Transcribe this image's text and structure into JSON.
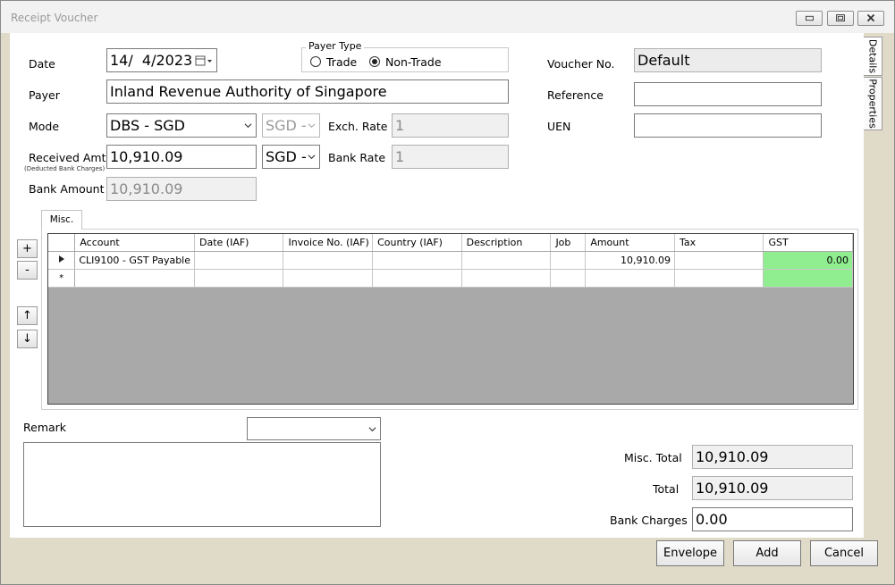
{
  "window": {
    "title": "Receipt Voucher"
  },
  "side_tabs": [
    "Details",
    "Properties"
  ],
  "form": {
    "date_label": "Date",
    "date_value": "14/  4/2023",
    "payer_type_title": "Payer Type",
    "payer_type_options": [
      "Trade",
      "Non-Trade"
    ],
    "payer_type_selected": "Non-Trade",
    "voucher_no_label": "Voucher No.",
    "voucher_no_value": "Default",
    "payer_label": "Payer",
    "payer_value": "Inland Revenue Authority of Singapore",
    "reference_label": "Reference",
    "reference_value": "",
    "mode_label": "Mode",
    "mode_value": "DBS - SGD",
    "mode_currency_value": "SGD -",
    "exch_rate_label": "Exch. Rate",
    "exch_rate_value": "1",
    "uen_label": "UEN",
    "uen_value": "",
    "received_amt_label": "Received Amt",
    "received_amt_note": "(Deducted Bank Charges)",
    "received_amt_value": "10,910.09",
    "received_currency_value": "SGD -",
    "bank_rate_label": "Bank Rate",
    "bank_rate_value": "1",
    "bank_amount_label": "Bank Amount",
    "bank_amount_value": "10,910.09"
  },
  "misc_tab": {
    "label": "Misc."
  },
  "side_buttons": {
    "add": "+",
    "remove": "-",
    "up": "↑",
    "down": "↓"
  },
  "grid": {
    "columns": [
      "Account",
      "Date (IAF)",
      "Invoice No. (IAF)",
      "Country (IAF)",
      "Description",
      "Job",
      "Amount",
      "Tax",
      "GST"
    ],
    "rows": [
      [
        "CLI9100 - GST Payable",
        "",
        "",
        "",
        "",
        "",
        "10,910.09",
        "",
        "0.00"
      ],
      [
        "",
        "",
        "",
        "",
        "",
        "",
        "",
        "",
        ""
      ]
    ],
    "new_row_marker": "*"
  },
  "remark": {
    "label": "Remark",
    "dropdown_value": "",
    "text": ""
  },
  "totals": {
    "misc_total_label": "Misc. Total",
    "misc_total_value": "10,910.09",
    "total_label": "Total",
    "total_value": "10,910.09",
    "bank_charges_label": "Bank Charges",
    "bank_charges_value": "0.00"
  },
  "buttons": {
    "envelope": "Envelope",
    "add": "Add",
    "cancel": "Cancel"
  },
  "colors": {
    "gst_cell": "#90EE90",
    "frame": "#DFDBC8"
  }
}
